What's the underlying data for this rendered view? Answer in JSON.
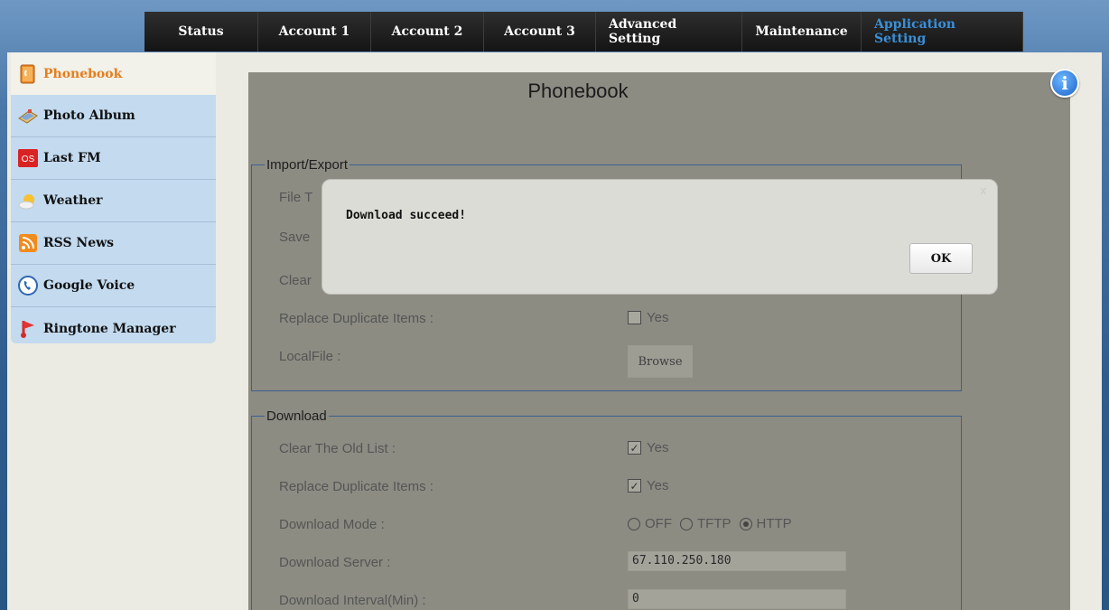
{
  "nav": {
    "tabs": [
      {
        "label": "Status"
      },
      {
        "label": "Account 1"
      },
      {
        "label": "Account 2"
      },
      {
        "label": "Account 3"
      },
      {
        "label": "Advanced Setting"
      },
      {
        "label": "Maintenance"
      },
      {
        "label": "Application Setting"
      }
    ],
    "active_tab": "Application Setting",
    "active_color": "#3a8fd8"
  },
  "sidebar": {
    "items": [
      {
        "label": "Phonebook",
        "icon": "phonebook-icon",
        "active": true
      },
      {
        "label": "Photo Album",
        "icon": "photo-album-icon"
      },
      {
        "label": "Last FM",
        "icon": "lastfm-icon"
      },
      {
        "label": "Weather",
        "icon": "weather-icon"
      },
      {
        "label": "RSS News",
        "icon": "rss-icon"
      },
      {
        "label": "Google Voice",
        "icon": "google-voice-icon"
      },
      {
        "label": "Ringtone Manager",
        "icon": "ringtone-icon"
      }
    ],
    "active_color": "#e47e1c"
  },
  "main": {
    "title": "Phonebook",
    "import_export": {
      "legend": "Import/Export",
      "file_type_label": "File T",
      "save_label": "Save",
      "clear_label": "Clear",
      "replace_label": "Replace Duplicate Items :",
      "replace_value": "Yes",
      "localfile_label": "LocalFile :",
      "browse_label": "Browse"
    },
    "download": {
      "legend": "Download",
      "clear_old_label": "Clear The Old List :",
      "clear_old_value": "Yes",
      "clear_old_checked": true,
      "replace_label": "Replace Duplicate Items :",
      "replace_value": "Yes",
      "replace_checked": true,
      "mode_label": "Download Mode :",
      "mode_options": [
        "OFF",
        "TFTP",
        "HTTP"
      ],
      "mode_selected": "HTTP",
      "server_label": "Download Server :",
      "server_value": "67.110.250.180",
      "interval_label": "Download Interval(Min) :",
      "interval_value": "0"
    }
  },
  "modal": {
    "message": "Download succeed!",
    "ok_label": "OK",
    "close_glyph": "x"
  },
  "info_glyph": "i"
}
